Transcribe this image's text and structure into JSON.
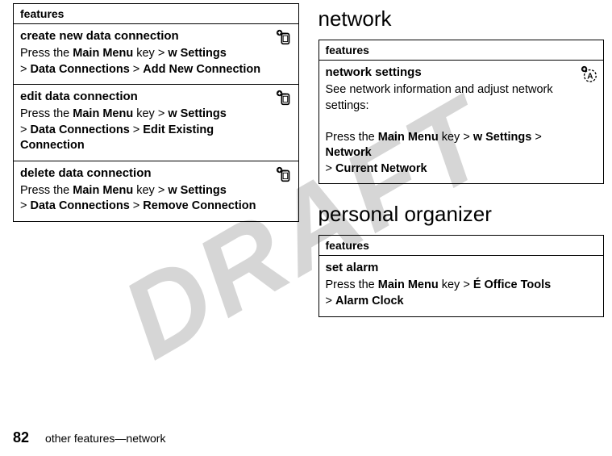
{
  "watermark": "DRAFT",
  "leftTable": {
    "header": "features",
    "rows": [
      {
        "title": "create new data connection",
        "prefix": "Press the ",
        "b1": "Main Menu",
        "mid1": " key > ",
        "iconGlyph": "w",
        "b2": " Settings",
        "mid2": " > ",
        "b3": "Data Connections",
        "mid3": " > ",
        "b4": "Add New Connection",
        "iconType": "sim"
      },
      {
        "title": "edit data connection",
        "prefix": "Press the ",
        "b1": "Main Menu",
        "mid1": " key > ",
        "iconGlyph": "w",
        "b2": " Settings",
        "mid2": " > ",
        "b3": "Data Connections",
        "mid3": " > ",
        "b4": "Edit Existing Connection",
        "iconType": "sim"
      },
      {
        "title": "delete data connection",
        "prefix": "Press the ",
        "b1": "Main Menu",
        "mid1": " key > ",
        "iconGlyph": "w",
        "b2": " Settings",
        "mid2": " > ",
        "b3": "Data Connections",
        "mid3": " > ",
        "b4": "Remove Connection",
        "iconType": "sim"
      }
    ]
  },
  "rightSections": [
    {
      "heading": "network",
      "table": {
        "header": "features",
        "rows": [
          {
            "title": "network settings",
            "line1": "See network information and adjust network settings:",
            "prefix": "Press the ",
            "b1": "Main Menu",
            "mid1": " key > ",
            "iconGlyph": "w",
            "b2": " Settings",
            "mid2": " > ",
            "b3": "Network",
            "mid3": " > ",
            "b4": "Current Network",
            "iconType": "antenna"
          }
        ]
      }
    },
    {
      "heading": "personal organizer",
      "table": {
        "header": "features",
        "rows": [
          {
            "title": "set alarm",
            "prefix": "Press the ",
            "b1": "Main Menu",
            "mid1": " key > ",
            "iconGlyph": "É",
            "b2": " Office Tools",
            "mid2": " > ",
            "b3": "Alarm Clock"
          }
        ]
      }
    }
  ],
  "footer": {
    "pageNumber": "82",
    "text": "other features—network"
  }
}
